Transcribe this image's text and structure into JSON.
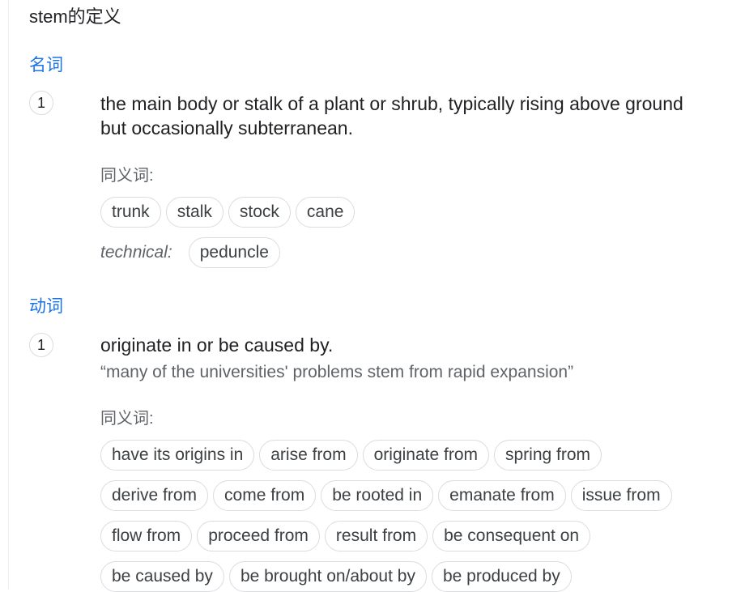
{
  "header": {
    "title": "stem的定义"
  },
  "noun": {
    "pos_label": "名词",
    "sense_number": "1",
    "definition": "the main body or stalk of a plant or shrub, typically rising above ground but occasionally subterranean.",
    "synonyms_label": "同义词:",
    "synonyms": [
      "trunk",
      "stalk",
      "stock",
      "cane"
    ],
    "technical_label": "technical:",
    "technical_synonyms": [
      "peduncle"
    ]
  },
  "verb": {
    "pos_label": "动词",
    "sense_number": "1",
    "definition": "originate in or be caused by.",
    "example": "“many of the universities' problems stem from rapid expansion”",
    "synonyms_label": "同义词:",
    "synonym_rows": [
      [
        "have its origins in",
        "arise from",
        "originate from",
        "spring from"
      ],
      [
        "derive from",
        "come from",
        "be rooted in",
        "emanate from",
        "issue from"
      ],
      [
        "flow from",
        "proceed from",
        "result from",
        "be consequent on"
      ],
      [
        "be caused by",
        "be brought on/about by",
        "be produced by"
      ]
    ]
  },
  "colors": {
    "accent": "#1a73e8",
    "text": "#202124",
    "muted": "#5f6368",
    "chip_border": "#dadce0"
  }
}
